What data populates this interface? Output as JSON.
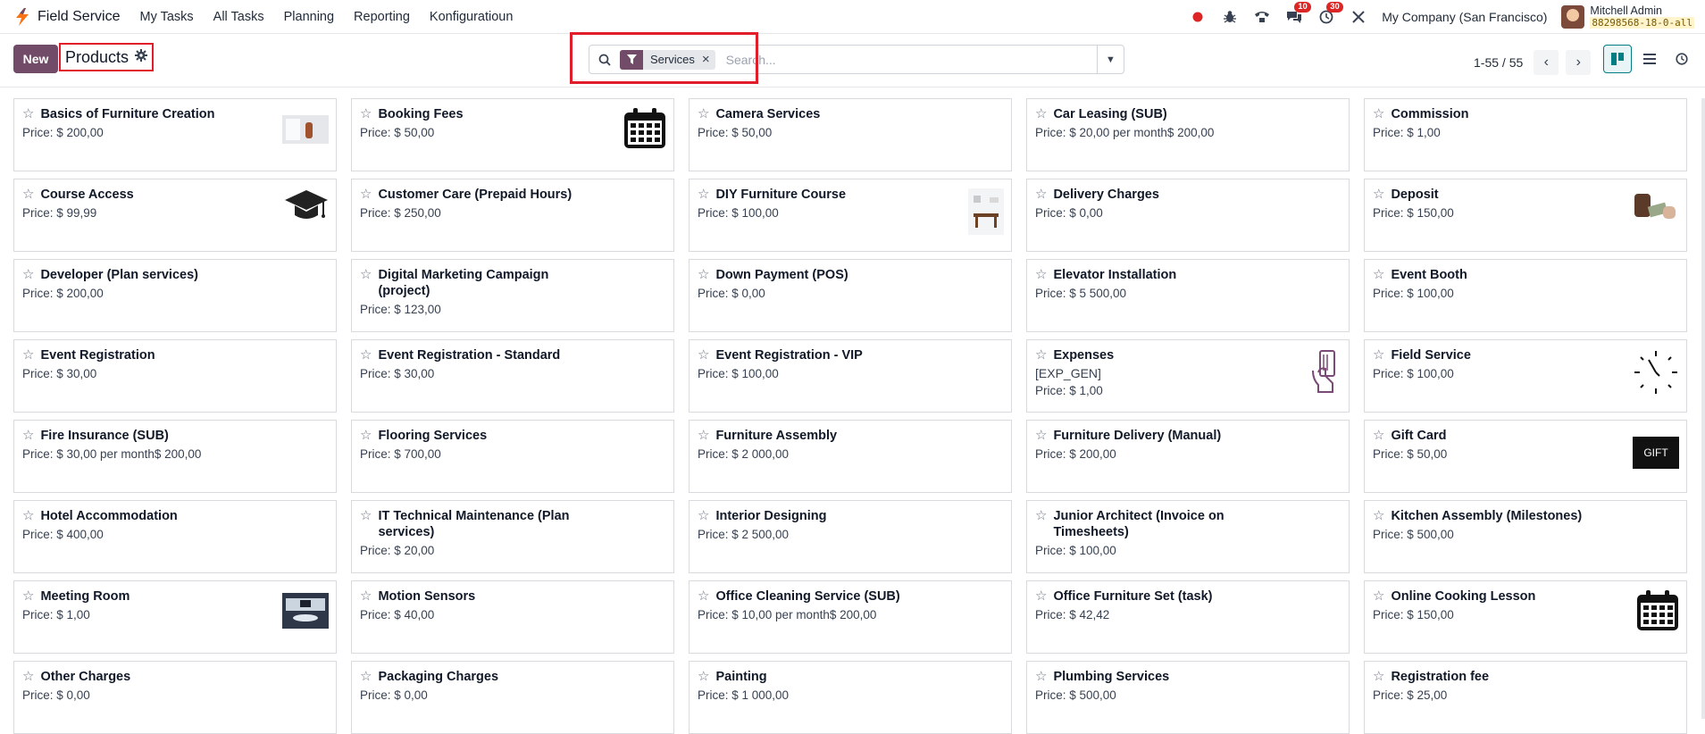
{
  "navbar": {
    "app_name": "Field Service",
    "menu": [
      "My Tasks",
      "All Tasks",
      "Planning",
      "Reporting",
      "Konfiguratioun"
    ],
    "messages_count": "10",
    "activities_count": "30",
    "company": "My Company (San Francisco)",
    "user_name": "Mitchell Admin",
    "db_name": "88298568-18-0-all"
  },
  "control": {
    "new_label": "New",
    "title": "Products",
    "facet_label": "Services",
    "search_placeholder": "Search...",
    "pager_value": "1-55 / 55"
  },
  "products": [
    {
      "name": "Basics of Furniture Creation",
      "price": "Price: $ 200,00",
      "image": "furniture-photo"
    },
    {
      "name": "Booking Fees",
      "price": "Price: $ 50,00",
      "image": "calendar-icon"
    },
    {
      "name": "Camera Services",
      "price": "Price: $ 50,00"
    },
    {
      "name": "Car Leasing (SUB)",
      "price": "Price: $ 20,00 per month$ 200,00"
    },
    {
      "name": "Commission",
      "price": "Price: $ 1,00"
    },
    {
      "name": "Course Access",
      "price": "Price: $ 99,99",
      "image": "graduation-cap-icon"
    },
    {
      "name": "Customer Care (Prepaid Hours)",
      "price": "Price: $ 250,00"
    },
    {
      "name": "DIY Furniture Course",
      "price": "Price: $ 100,00",
      "image": "dining-photo"
    },
    {
      "name": "Delivery Charges",
      "price": "Price: $ 0,00"
    },
    {
      "name": "Deposit",
      "price": "Price: $ 150,00",
      "image": "money-photo"
    },
    {
      "name": "Developer (Plan services)",
      "price": "Price: $ 200,00"
    },
    {
      "name": "Digital Marketing Campaign (project)",
      "price": "Price: $ 123,00"
    },
    {
      "name": "Down Payment (POS)",
      "price": "Price: $ 0,00"
    },
    {
      "name": "Elevator Installation",
      "price": "Price: $ 5 500,00"
    },
    {
      "name": "Event Booth",
      "price": "Price: $ 100,00"
    },
    {
      "name": "Event Registration",
      "price": "Price: $ 30,00"
    },
    {
      "name": "Event Registration - Standard",
      "price": "Price: $ 30,00"
    },
    {
      "name": "Event Registration - VIP",
      "price": "Price: $ 100,00"
    },
    {
      "name": "Expenses",
      "code": "[EXP_GEN]",
      "price": "Price: $ 1,00",
      "image": "card-hand-icon"
    },
    {
      "name": "Field Service",
      "price": "Price: $ 100,00",
      "image": "clock-icon"
    },
    {
      "name": "Fire Insurance (SUB)",
      "price": "Price: $ 30,00 per month$ 200,00"
    },
    {
      "name": "Flooring Services",
      "price": "Price: $ 700,00"
    },
    {
      "name": "Furniture Assembly",
      "price": "Price: $ 2 000,00"
    },
    {
      "name": "Furniture Delivery (Manual)",
      "price": "Price: $ 200,00"
    },
    {
      "name": "Gift Card",
      "price": "Price: $ 50,00",
      "image": "gift-card-icon",
      "image_text": "GIFT"
    },
    {
      "name": "Hotel Accommodation",
      "price": "Price: $ 400,00"
    },
    {
      "name": "IT Technical Maintenance (Plan services)",
      "price": "Price: $ 20,00"
    },
    {
      "name": "Interior Designing",
      "price": "Price: $ 2 500,00"
    },
    {
      "name": "Junior Architect (Invoice on Timesheets)",
      "price": "Price: $ 100,00"
    },
    {
      "name": "Kitchen Assembly (Milestones)",
      "price": "Price: $ 500,00"
    },
    {
      "name": "Meeting Room",
      "price": "Price: $ 1,00",
      "image": "meeting-room-photo"
    },
    {
      "name": "Motion Sensors",
      "price": "Price: $ 40,00"
    },
    {
      "name": "Office Cleaning Service (SUB)",
      "price": "Price: $ 10,00 per month$ 200,00"
    },
    {
      "name": "Office Furniture Set (task)",
      "price": "Price: $ 42,42"
    },
    {
      "name": "Online Cooking Lesson",
      "price": "Price: $ 150,00",
      "image": "calendar-icon"
    },
    {
      "name": "Other Charges",
      "price": "Price: $ 0,00"
    },
    {
      "name": "Packaging Charges",
      "price": "Price: $ 0,00"
    },
    {
      "name": "Painting",
      "price": "Price: $ 1 000,00"
    },
    {
      "name": "Plumbing Services",
      "price": "Price: $ 500,00"
    },
    {
      "name": "Registration fee",
      "price": "Price: $ 25,00"
    }
  ],
  "colors": {
    "brand": "#714b67",
    "highlight": "#e11d2a",
    "badge": "#dc2626",
    "active_view": "#017e84"
  }
}
